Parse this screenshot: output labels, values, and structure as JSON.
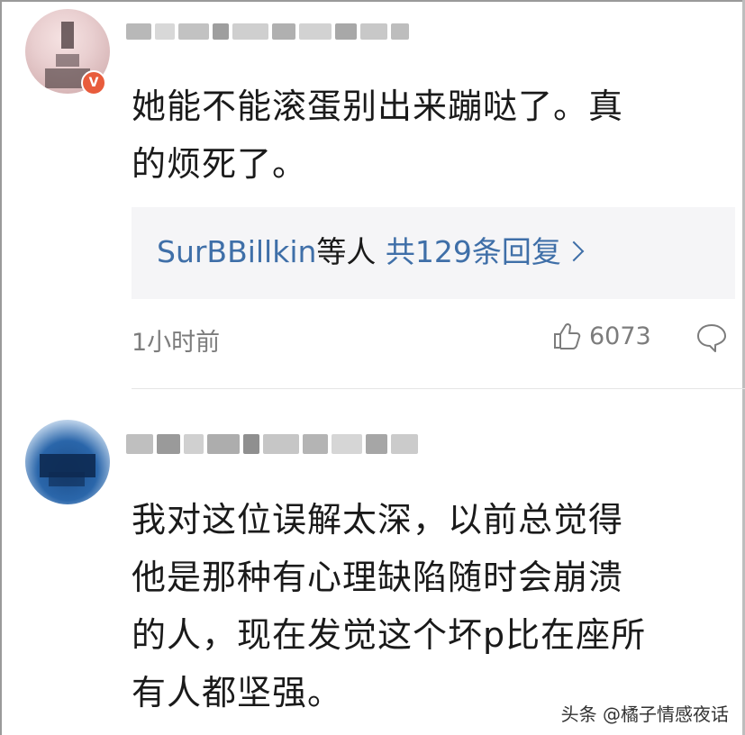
{
  "comment1": {
    "avatar_badge": "V",
    "text_line1": "她能不能滚蛋别出来蹦哒了。真",
    "text_line2": "的烦死了。",
    "reply_user": "SurBBillkin",
    "reply_mid": "等人",
    "reply_count": "共129条回复",
    "time": "1小时前",
    "likes": "6073",
    "icons": {
      "like": "thumbs-up-icon",
      "comment": "speech-bubble-icon",
      "chevron": "chevron-right-icon"
    }
  },
  "comment2": {
    "text_line1": "我对这位误解太深，以前总觉得",
    "text_line2": "他是那种有心理缺陷随时会崩溃",
    "text_line3": "的人，现在发觉这个坏p比在座所",
    "text_line4": "有人都坚强。"
  },
  "watermark": "头条 @橘子情感夜话",
  "colors": {
    "link": "#3f6fa8",
    "meta": "#7c7c7c",
    "reply_bg": "#f5f5f7",
    "badge": "#e85c3c"
  }
}
